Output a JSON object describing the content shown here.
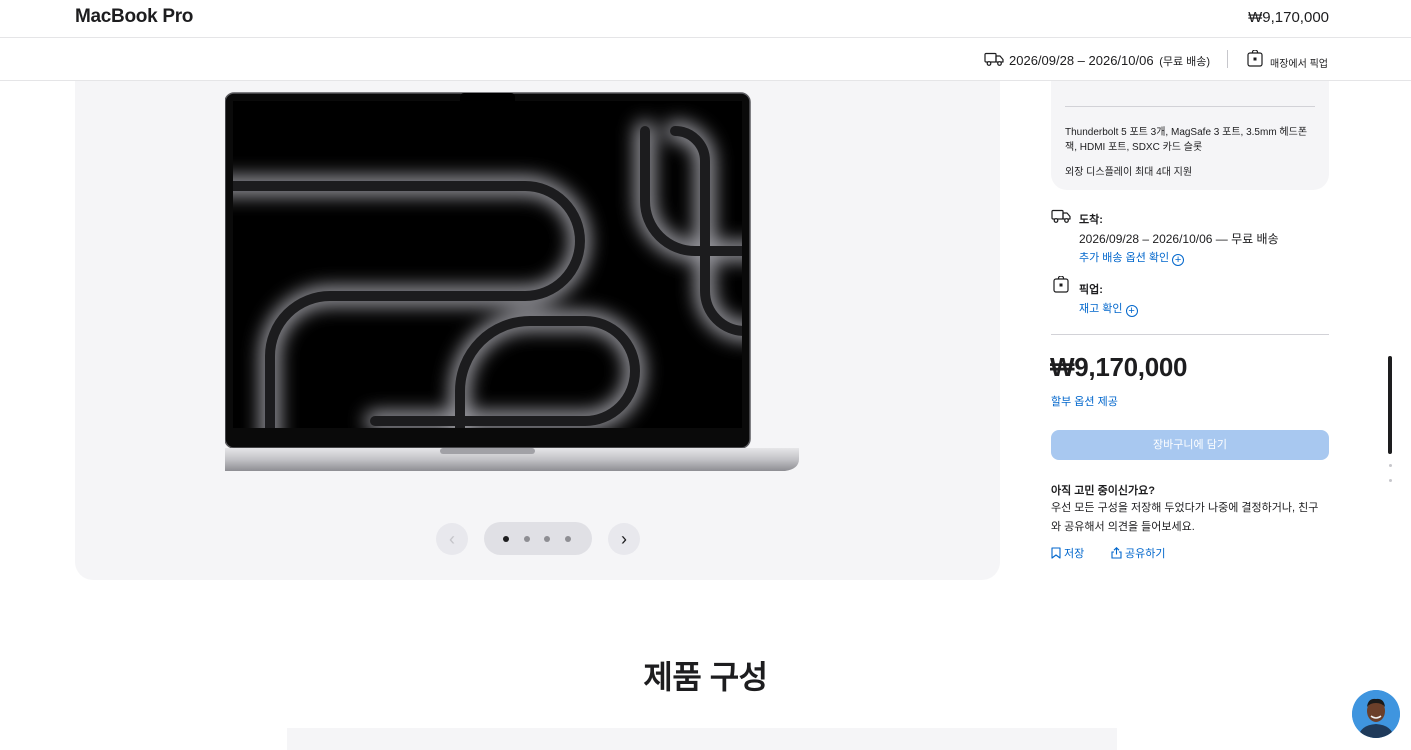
{
  "header": {
    "product_title": "MacBook Pro",
    "price": "₩9,170,000"
  },
  "delivery_bar": {
    "dates": "2026/09/28 – 2026/10/06",
    "free_label": "(무료 배송)",
    "pickup_label": "매장에서 픽업"
  },
  "gallery": {
    "image_icon": "macbook-pro-image",
    "slide_count": 4,
    "active_slide": 1,
    "prev_icon": "chevron-left-icon",
    "next_icon": "chevron-right-icon"
  },
  "specs": {
    "ports": "Thunderbolt 5 포트 3개, MagSafe 3 포트, 3.5mm 헤드폰 잭, HDMI 포트, SDXC 카드 슬롯",
    "display": "외장 디스플레이 최대 4대 지원"
  },
  "fulfillment": {
    "arrive_label": "도착:",
    "arrive_dates": "2026/09/28 – 2026/10/06 — 무료 배송",
    "more_shipping_link": "추가 배송 옵션 확인",
    "pickup_label": "픽업:",
    "stock_link": "재고 확인"
  },
  "purchase": {
    "price": "₩9,170,000",
    "installment_link": "할부 옵션 제공",
    "cart_button": "장바구니에 담기",
    "cart_button_color": "#a8c8f0"
  },
  "undecided": {
    "title": "아직 고민 중이신가요?",
    "body": "우선 모든 구성을 저장해 두었다가 나중에 결정하거나, 친구와 공유해서 의견을 들어보세요.",
    "save_label": "저장",
    "share_label": "공유하기"
  },
  "section": {
    "title": "제품 구성"
  },
  "colors": {
    "link": "#0066cc",
    "text": "#1d1d1f",
    "panel": "#f5f5f7"
  }
}
